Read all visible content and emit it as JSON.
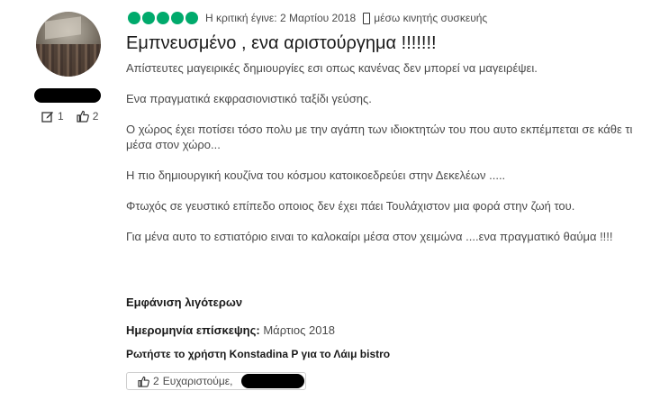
{
  "reviewer": {
    "review_count": "1",
    "helpful_votes": "2"
  },
  "review": {
    "rating": 5,
    "rating_color": "#00aa6c",
    "date_text": "Η κριτική έγινε: 2 Μαρτίου 2018",
    "device_text": "μέσω κινητής συσκευής",
    "title": "Εμπνευσμένο , ενα αριστούργημα !!!!!!!",
    "paragraphs": [
      "Απίστευτες μαγειρικές δημιουργίες εσι οπως κανένας δεν μπορεί να μαγειρέψει.",
      "Ενα πραγματικά εκφρασιονιστικό ταξίδι γεύσης.",
      "Ο χώρος έχει ποτίσει τόσο πολυ με την αγάπη των ιδιοκτητών του που αυτο εκπέμπεται σε κάθε τι μέσα στον χώρο...",
      "Η πιο δημιουργική κουζίνα του κόσμου κατοικοεδρεύει στην Δεκελέων .....",
      "Φτωχός σε γευστικό επίπεδο οποιος δεν έχει πάει Τουλάχιστον μια φορά στην ζωή του.",
      "Για μένα αυτο το εστιατόριο ειναι το καλοκαίρι μέσα στον χειμώνα ....ενα πραγματικό θαύμα !!!!"
    ],
    "show_less": "Εμφάνιση λιγότερων",
    "visit_label": "Ημερομηνία επίσκεψης:",
    "visit_value": "Μάρτιος 2018",
    "ask_text": "Ρωτήστε το χρήστη Konstadina P για το Λάιμ bistro",
    "thanks_count": "2",
    "thanks_text": "Ευχαριστούμε,"
  }
}
